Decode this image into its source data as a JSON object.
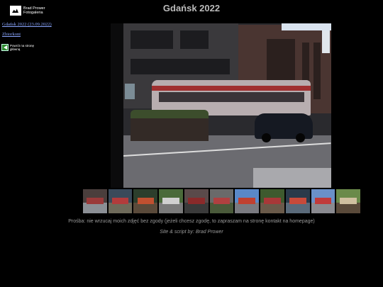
{
  "sidebar": {
    "logo_line1": "Brad Prower",
    "logo_line2": "Fotogaleria",
    "album_link": "Gdańsk 2022 (23.09.2022)",
    "zoom_link": "Zbiorkont",
    "back_line1": "Powrót na stronę",
    "back_line2": "główną"
  },
  "page": {
    "title": "Gdańsk 2022"
  },
  "photo": {
    "subject": "tram-street-photo"
  },
  "filmstrip": {
    "thumbnails": [
      {
        "top": "#4a3e3c",
        "bottom": "#8b8f95",
        "mid": "#9a3a3a"
      },
      {
        "top": "#3a4a5a",
        "bottom": "#6e6a5a",
        "mid": "#b23c3c"
      },
      {
        "top": "#2c3e2c",
        "bottom": "#5a4a3a",
        "mid": "#c05030"
      },
      {
        "top": "#4a6a3a",
        "bottom": "#7a7a7a",
        "mid": "#d0d0d0"
      },
      {
        "top": "#5a4a4a",
        "bottom": "#3a3a3a",
        "mid": "#8a2a2a"
      },
      {
        "top": "#6a6a6a",
        "bottom": "#4a5a3a",
        "mid": "#b04040"
      },
      {
        "top": "#5a88c8",
        "bottom": "#7a7a80",
        "mid": "#c04030"
      },
      {
        "top": "#3e5a2e",
        "bottom": "#6a5a4a",
        "mid": "#a83838"
      },
      {
        "top": "#2a3a4a",
        "bottom": "#5a6a7a",
        "mid": "#c84a3a"
      },
      {
        "top": "#6a90c8",
        "bottom": "#8a8a90",
        "mid": "#c03a3a"
      },
      {
        "top": "#6a8a4a",
        "bottom": "#5a4a3a",
        "mid": "#d0c0a0"
      }
    ]
  },
  "footer": {
    "notice": "Prośba: nie wrzucaj moich zdjęć bez zgody (jeżeli chcesz zgodę, to zapraszam na stronę kontakt na homepage)",
    "credit": "Site & script by: Brad Prower"
  }
}
